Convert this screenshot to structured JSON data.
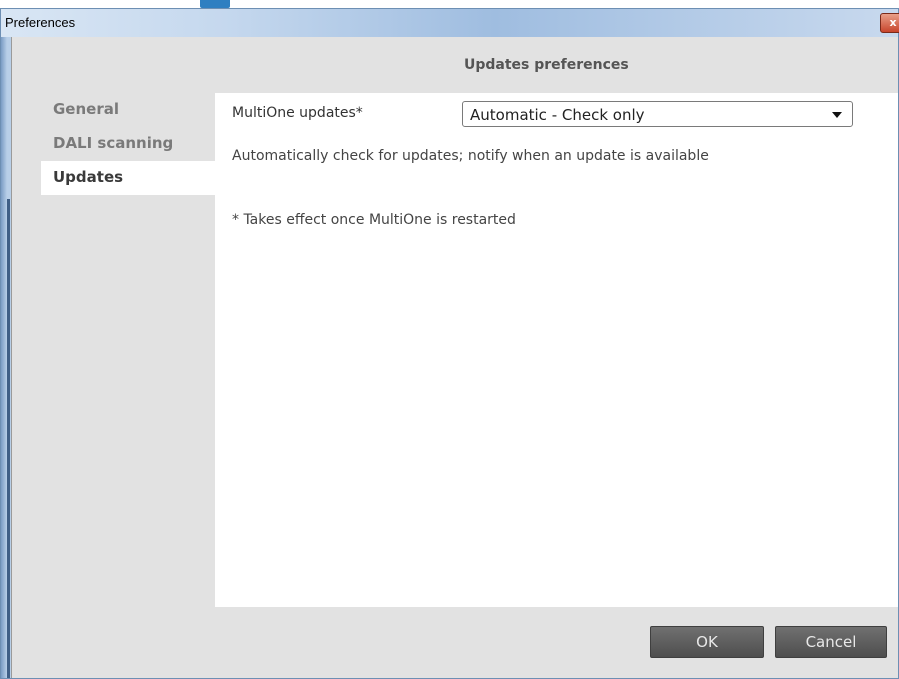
{
  "window": {
    "title": "Preferences",
    "close_glyph": "x"
  },
  "header": {
    "title": "Updates preferences"
  },
  "sidebar": {
    "items": [
      {
        "label": "General",
        "active": false
      },
      {
        "label": "DALI scanning",
        "active": false
      },
      {
        "label": "Updates",
        "active": true
      }
    ]
  },
  "updates": {
    "field_label": "MultiOne updates*",
    "dropdown_value": "Automatic - Check only",
    "description": "Automatically check for updates; notify when an update is available",
    "note": "* Takes effect once MultiOne is restarted"
  },
  "buttons": {
    "ok": "OK",
    "cancel": "Cancel"
  },
  "icons": {
    "close": "close-icon",
    "dropdown": "chevron-down-icon"
  },
  "colors": {
    "title_bar": "#c5d8ee",
    "panel_bg": "#e2e2e2",
    "content_bg": "#ffffff",
    "button_bg": "#5a5a5a",
    "close_button": "#c8452c",
    "header_accent": "#2f7fc1"
  }
}
